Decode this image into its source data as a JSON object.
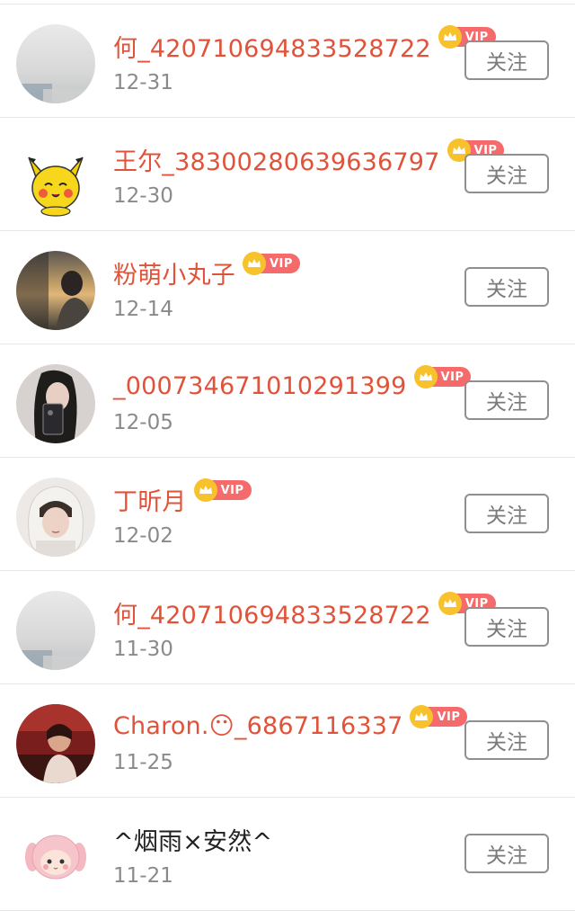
{
  "follow_label": "关注",
  "colors": {
    "name": "#e0533a",
    "name_plain": "#222222",
    "vip_badge": "#f56b6b",
    "crown": "#f7c22c"
  },
  "vip_label": "VIP",
  "users": [
    {
      "name": "何_420710694833528722",
      "date": "12-31",
      "vip": true,
      "avatar": "blurred-landscape"
    },
    {
      "name": "王尔_38300280639636797",
      "date": "12-30",
      "vip": true,
      "avatar": "cartoon-pikachu"
    },
    {
      "name": "粉萌小丸子",
      "date": "12-14",
      "vip": true,
      "avatar": "sunset-window"
    },
    {
      "name": "_000734671010291399",
      "date": "12-05",
      "vip": true,
      "avatar": "mirror-selfie"
    },
    {
      "name": "丁昕月",
      "date": "12-02",
      "vip": true,
      "avatar": "hooded-portrait"
    },
    {
      "name": "何_420710694833528722",
      "date": "11-30",
      "vip": true,
      "avatar": "blurred-landscape"
    },
    {
      "name": "Charon.😶_6867116337",
      "date": "11-25",
      "vip": true,
      "avatar": "red-interior-portrait"
    },
    {
      "name": "^烟雨×安然^",
      "date": "11-21",
      "vip": false,
      "avatar": "cartoon-pink-bunny"
    }
  ]
}
